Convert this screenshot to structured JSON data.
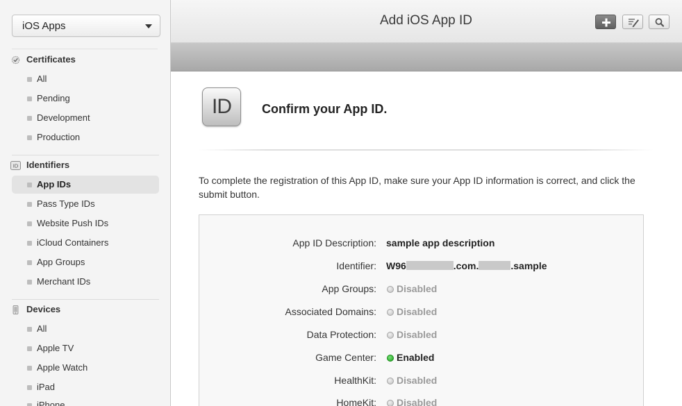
{
  "sidebar": {
    "selector": {
      "label": "iOS Apps",
      "icon": "chevron-down-icon"
    },
    "sections": [
      {
        "title": "Certificates",
        "icon": "certificate-seal-icon",
        "items": [
          "All",
          "Pending",
          "Development",
          "Production"
        ]
      },
      {
        "title": "Identifiers",
        "icon": "id-badge-icon",
        "items": [
          "App IDs",
          "Pass Type IDs",
          "Website Push IDs",
          "iCloud Containers",
          "App Groups",
          "Merchant IDs"
        ],
        "active_index": 0
      },
      {
        "title": "Devices",
        "icon": "device-phone-icon",
        "items": [
          "All",
          "Apple TV",
          "Apple Watch",
          "iPad",
          "iPhone"
        ]
      }
    ]
  },
  "header": {
    "title": "Add iOS App ID",
    "buttons": [
      {
        "name": "add-button",
        "icon": "plus-icon"
      },
      {
        "name": "edit-button",
        "icon": "pencil-edit-icon"
      },
      {
        "name": "search-button",
        "icon": "search-icon"
      }
    ]
  },
  "main": {
    "icon_text": "ID",
    "heading": "Confirm your App ID.",
    "instructions": "To complete the registration of this App ID, make sure your App ID information is correct, and click the submit button.",
    "details": {
      "description": {
        "label": "App ID Description:",
        "value": "sample app description"
      },
      "identifier": {
        "label": "Identifier:",
        "prefix": "W96",
        "middle": ".com.",
        "suffix": ".sample"
      },
      "capabilities": [
        {
          "label": "App Groups:",
          "status": "Disabled",
          "enabled": false
        },
        {
          "label": "Associated Domains:",
          "status": "Disabled",
          "enabled": false
        },
        {
          "label": "Data Protection:",
          "status": "Disabled",
          "enabled": false
        },
        {
          "label": "Game Center:",
          "status": "Enabled",
          "enabled": true
        },
        {
          "label": "HealthKit:",
          "status": "Disabled",
          "enabled": false
        },
        {
          "label": "HomeKit:",
          "status": "Disabled",
          "enabled": false
        }
      ]
    }
  },
  "colors": {
    "enabled": "#1ca31c",
    "disabled": "#9a9a9a",
    "sidebar_bg": "#f4f4f4",
    "subbar": "#b3b3b3"
  }
}
